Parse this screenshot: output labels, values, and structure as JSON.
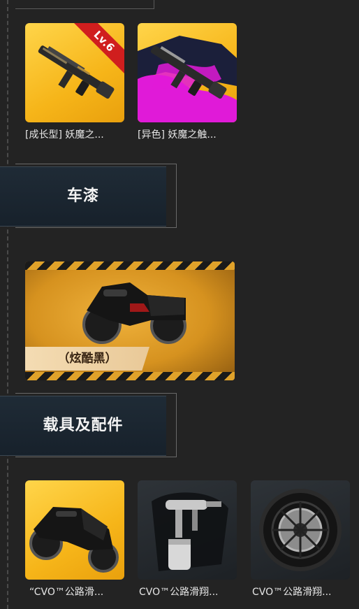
{
  "top_items": [
    {
      "label": "[成长型] 妖魔之...",
      "badge": "Lv.6",
      "icon": "assault-rifle-icon"
    },
    {
      "label": "[异色] 妖魔之触...",
      "icon": "assault-rifle-magenta-icon"
    }
  ],
  "sections": {
    "paint": "车漆",
    "vehicle": "载具及配件"
  },
  "paint_banner": {
    "label": "（炫酷黑）",
    "icon": "motorcycle-icon"
  },
  "vehicle_items": [
    {
      "label": "“CVO™公路滑...",
      "icon": "motorcycle-icon"
    },
    {
      "label": "CVO™公路滑翔...",
      "icon": "spray-gun-icon"
    },
    {
      "label": "CVO™公路滑翔...",
      "icon": "wheel-icon"
    }
  ],
  "colors": {
    "background": "#232323",
    "gold": "#f6b519",
    "magenta": "#e01ad8",
    "badge_red": "#d01e1e",
    "section_bg": "#1f2b36"
  }
}
